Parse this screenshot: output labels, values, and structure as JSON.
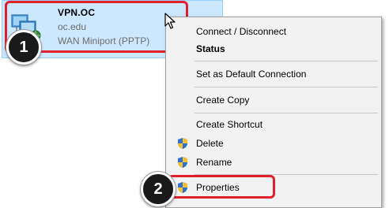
{
  "connection": {
    "name": "VPN.OC",
    "domain": "oc.edu",
    "device": "WAN Miniport (PPTP)",
    "icon": "network-connection-icon"
  },
  "steps": {
    "step1": "1",
    "step2": "2"
  },
  "context_menu": {
    "items": [
      {
        "label": "Connect / Disconnect",
        "bold": false,
        "shield": false
      },
      {
        "label": "Status",
        "bold": true,
        "shield": false
      },
      {
        "label": "Set as Default Connection",
        "bold": false,
        "shield": false
      },
      {
        "label": "Create Copy",
        "bold": false,
        "shield": false
      },
      {
        "label": "Create Shortcut",
        "bold": false,
        "shield": false
      },
      {
        "label": "Delete",
        "bold": false,
        "shield": true
      },
      {
        "label": "Rename",
        "bold": false,
        "shield": true
      },
      {
        "label": "Properties",
        "bold": false,
        "shield": true
      }
    ]
  },
  "colors": {
    "highlight": "#e0202b",
    "selection": "#cce8ff",
    "menu_background": "#f2f2f2"
  }
}
